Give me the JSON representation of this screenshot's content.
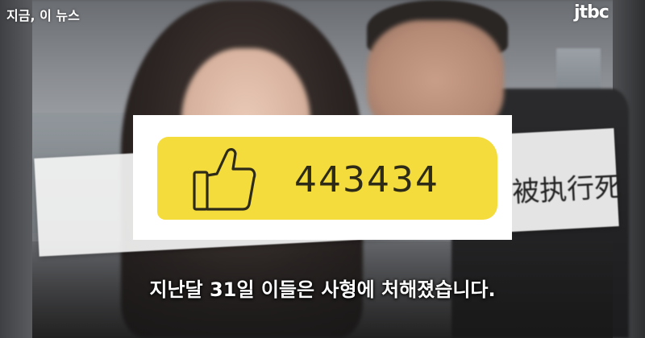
{
  "channel": {
    "program_label": "지금, 이 뉴스",
    "logo_text": "jtbc"
  },
  "overlay_comment": {
    "visible_text": "被执行死"
  },
  "like_card": {
    "icon": "thumbs-up-icon",
    "count": "443434",
    "highlight_color": "#f4dc3c"
  },
  "subtitle": {
    "text": "지난달 31일 이들은 사형에 처해졌습니다."
  }
}
